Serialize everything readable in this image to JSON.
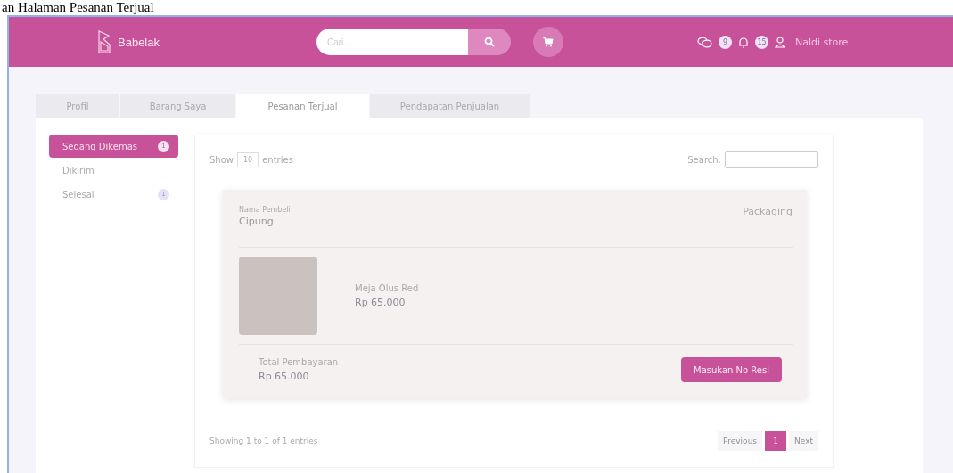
{
  "caption": "an Halaman Pesanan Terjual",
  "header": {
    "brand": "Babelak",
    "search": {
      "placeholder": "Cari..."
    },
    "chat_count": "9",
    "notification_count": "15",
    "user": "Naldi store"
  },
  "tabs": [
    {
      "label": "Profil",
      "selected": false
    },
    {
      "label": "Barang Saya",
      "selected": false
    },
    {
      "label": "Pesanan Terjual",
      "selected": true
    },
    {
      "label": "Pendapatan Penjualan",
      "selected": false
    }
  ],
  "sidebar": {
    "items": [
      {
        "label": "Sedang Dikemas",
        "badge": "1",
        "selected": true
      },
      {
        "label": "Dikirim",
        "selected": false
      },
      {
        "label": "Selesai",
        "badge": "1",
        "selected": false
      }
    ]
  },
  "table": {
    "show_label": "Show",
    "page_size": "10",
    "entries_label": "entries",
    "search_label": "Search:",
    "order": {
      "buyer_label": "Nama Pembeli",
      "buyer": "Cipung",
      "status": "Packaging",
      "product_name": "Meja Olus Red",
      "product_price": "Rp 65.000",
      "total_label": "Total Pembayaran",
      "total": "Rp 65.000",
      "action": "Masukan No Resi"
    },
    "info": "Showing 1 to 1 of 1 entries",
    "pagination": [
      {
        "label": "Previous",
        "selected": false
      },
      {
        "label": "1",
        "selected": true
      },
      {
        "label": "Next",
        "selected": false
      }
    ]
  }
}
